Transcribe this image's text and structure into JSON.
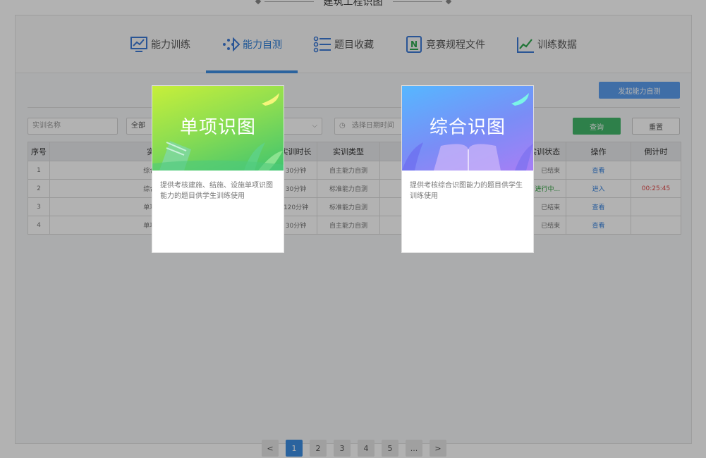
{
  "page": {
    "title": "建筑工程识图"
  },
  "tabs": [
    {
      "label": "能力训练",
      "icon": "chart-board-icon",
      "active": false
    },
    {
      "label": "能力自测",
      "icon": "arrow-nodes-icon",
      "active": true
    },
    {
      "label": "题目收藏",
      "icon": "list-icon",
      "active": false
    },
    {
      "label": "竞赛规程文件",
      "icon": "document-n-icon",
      "active": false
    },
    {
      "label": "训练数据",
      "icon": "line-chart-icon",
      "active": false
    }
  ],
  "toolbar": {
    "start_label": "发起能力自测"
  },
  "filters": {
    "name_placeholder": "实训名称",
    "type_value": "全部",
    "date_placeholder": "选择日期时间",
    "query_label": "查询",
    "reset_label": "重置"
  },
  "table": {
    "headers": [
      "序号",
      "实训名称",
      "实训时长",
      "实训类型",
      "实训状态",
      "操作",
      "倒计时"
    ],
    "rows": [
      {
        "no": "1",
        "name": "综合识图实训",
        "duration": "30分钟",
        "type": "自主能力自测",
        "status": "已结束",
        "action": "查看",
        "countdown": ""
      },
      {
        "no": "2",
        "name": "综合识图实训",
        "duration": "30分钟",
        "type": "标准能力自测",
        "status": "进行中...",
        "action": "进入",
        "countdown": "00:25:45"
      },
      {
        "no": "3",
        "name": "单项识图实训",
        "duration": "120分钟",
        "type": "标准能力自测",
        "status": "已结束",
        "action": "查看",
        "countdown": ""
      },
      {
        "no": "4",
        "name": "单项识图实训",
        "duration": "30分钟",
        "type": "自主能力自测",
        "status": "已结束",
        "action": "查看",
        "countdown": ""
      }
    ]
  },
  "pager": {
    "prev": "<",
    "pages": [
      "1",
      "2",
      "3",
      "4",
      "5",
      "..."
    ],
    "next": ">",
    "current": "1"
  },
  "cards": [
    {
      "title": "单项识图",
      "desc": "提供考核建施、结施、设施单项识图能力的题目供学生训练使用",
      "colors": [
        "#c7ef3a",
        "#3fc46f"
      ]
    },
    {
      "title": "综合识图",
      "desc": "提供考核综合识图能力的题目供学生训练使用",
      "colors": [
        "#56b7ff",
        "#a77ef5"
      ]
    }
  ]
}
